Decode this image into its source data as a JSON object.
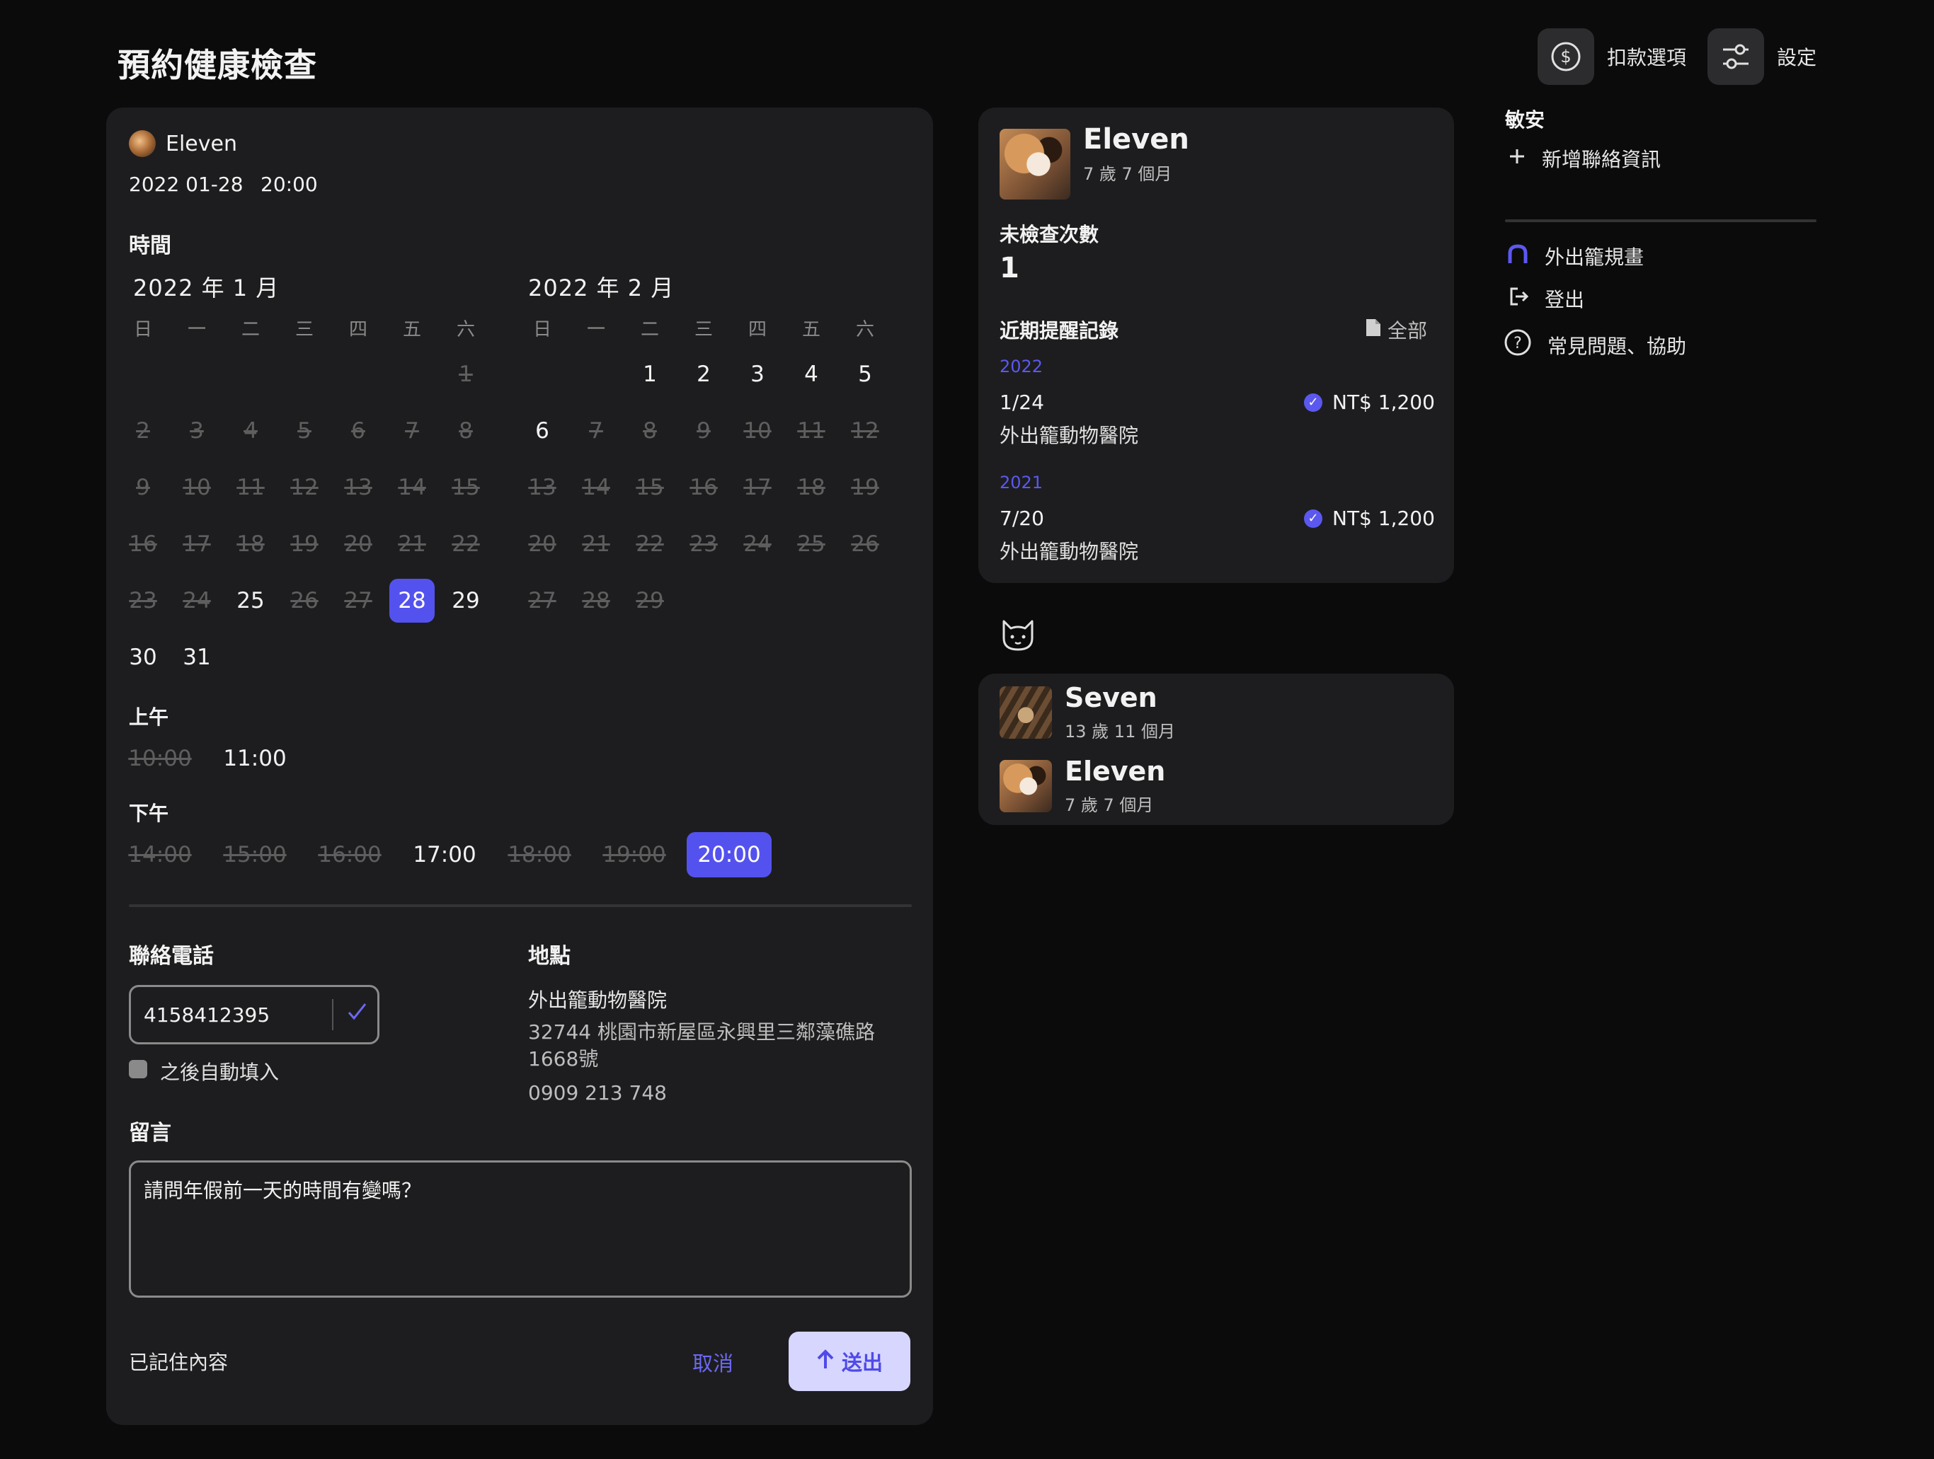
{
  "page": {
    "title": "預約健康檢查"
  },
  "top_actions": {
    "payment_label": "扣款選項",
    "settings_label": "設定"
  },
  "booking": {
    "pet_name": "Eleven",
    "date": "2022 01-28",
    "time": "20:00",
    "time_heading": "時間",
    "weekdays": [
      "日",
      "一",
      "二",
      "三",
      "四",
      "五",
      "六"
    ],
    "jan": {
      "title": "2022 年 1 月",
      "days": [
        {
          "d": "",
          "s": "empty"
        },
        {
          "d": "",
          "s": "empty"
        },
        {
          "d": "",
          "s": "empty"
        },
        {
          "d": "",
          "s": "empty"
        },
        {
          "d": "",
          "s": "empty"
        },
        {
          "d": "",
          "s": "empty"
        },
        {
          "d": "1",
          "s": "off"
        },
        {
          "d": "2",
          "s": "off"
        },
        {
          "d": "3",
          "s": "off"
        },
        {
          "d": "4",
          "s": "off"
        },
        {
          "d": "5",
          "s": "off"
        },
        {
          "d": "6",
          "s": "off"
        },
        {
          "d": "7",
          "s": "off"
        },
        {
          "d": "8",
          "s": "off"
        },
        {
          "d": "9",
          "s": "off"
        },
        {
          "d": "10",
          "s": "off"
        },
        {
          "d": "11",
          "s": "off"
        },
        {
          "d": "12",
          "s": "off"
        },
        {
          "d": "13",
          "s": "off"
        },
        {
          "d": "14",
          "s": "off"
        },
        {
          "d": "15",
          "s": "off"
        },
        {
          "d": "16",
          "s": "off"
        },
        {
          "d": "17",
          "s": "off"
        },
        {
          "d": "18",
          "s": "off"
        },
        {
          "d": "19",
          "s": "off"
        },
        {
          "d": "20",
          "s": "off"
        },
        {
          "d": "21",
          "s": "off"
        },
        {
          "d": "22",
          "s": "off"
        },
        {
          "d": "23",
          "s": "off"
        },
        {
          "d": "24",
          "s": "off"
        },
        {
          "d": "25",
          "s": "on"
        },
        {
          "d": "26",
          "s": "off"
        },
        {
          "d": "27",
          "s": "off"
        },
        {
          "d": "28",
          "s": "sel"
        },
        {
          "d": "29",
          "s": "on"
        },
        {
          "d": "30",
          "s": "on"
        },
        {
          "d": "31",
          "s": "on"
        }
      ]
    },
    "feb": {
      "title": "2022 年 2 月",
      "days": [
        {
          "d": "",
          "s": "empty"
        },
        {
          "d": "",
          "s": "empty"
        },
        {
          "d": "1",
          "s": "on"
        },
        {
          "d": "2",
          "s": "on"
        },
        {
          "d": "3",
          "s": "on"
        },
        {
          "d": "4",
          "s": "on"
        },
        {
          "d": "5",
          "s": "on"
        },
        {
          "d": "6",
          "s": "on"
        },
        {
          "d": "7",
          "s": "off"
        },
        {
          "d": "8",
          "s": "off"
        },
        {
          "d": "9",
          "s": "off"
        },
        {
          "d": "10",
          "s": "off"
        },
        {
          "d": "11",
          "s": "off"
        },
        {
          "d": "12",
          "s": "off"
        },
        {
          "d": "13",
          "s": "off"
        },
        {
          "d": "14",
          "s": "off"
        },
        {
          "d": "15",
          "s": "off"
        },
        {
          "d": "16",
          "s": "off"
        },
        {
          "d": "17",
          "s": "off"
        },
        {
          "d": "18",
          "s": "off"
        },
        {
          "d": "19",
          "s": "off"
        },
        {
          "d": "20",
          "s": "off"
        },
        {
          "d": "21",
          "s": "off"
        },
        {
          "d": "22",
          "s": "off"
        },
        {
          "d": "23",
          "s": "off"
        },
        {
          "d": "24",
          "s": "off"
        },
        {
          "d": "25",
          "s": "off"
        },
        {
          "d": "26",
          "s": "off"
        },
        {
          "d": "27",
          "s": "off"
        },
        {
          "d": "28",
          "s": "off"
        },
        {
          "d": "29",
          "s": "off"
        }
      ]
    },
    "morning_label": "上午",
    "morning_slots": [
      {
        "t": "10:00",
        "s": "off"
      },
      {
        "t": "11:00",
        "s": "on"
      }
    ],
    "afternoon_label": "下午",
    "afternoon_slots": [
      {
        "t": "14:00",
        "s": "off"
      },
      {
        "t": "15:00",
        "s": "off"
      },
      {
        "t": "16:00",
        "s": "off"
      },
      {
        "t": "17:00",
        "s": "on"
      },
      {
        "t": "18:00",
        "s": "off"
      },
      {
        "t": "19:00",
        "s": "off"
      },
      {
        "t": "20:00",
        "s": "sel"
      }
    ],
    "phone_label": "聯絡電話",
    "phone_value": "4158412395",
    "autofill_label": "之後自動填入",
    "location_label": "地點",
    "clinic_name": "外出籠動物醫院",
    "clinic_address": "32744 桃園市新屋區永興里三鄰藻礁路 1668號",
    "clinic_phone": "0909 213 748",
    "message_label": "留言",
    "message_value": "請問年假前一天的時間有變嗎？",
    "remembered_label": "已記住內容",
    "cancel_label": "取消",
    "send_label": "送出"
  },
  "pet_profile": {
    "name": "Eleven",
    "age": "7 歲 7 個月",
    "unchecked_label": "未檢查次數",
    "unchecked_count": "1",
    "reminders_label": "近期提醒記錄",
    "all_label": "全部",
    "records": [
      {
        "year": "2022",
        "date": "1/24",
        "clinic": "外出籠動物醫院",
        "amount": "NT$ 1,200"
      },
      {
        "year": "2021",
        "date": "7/20",
        "clinic": "外出籠動物醫院",
        "amount": "NT$ 1,200"
      }
    ]
  },
  "pets": [
    {
      "name": "Seven",
      "age": "13 歲 11 個月"
    },
    {
      "name": "Eleven",
      "age": "7 歲 7 個月"
    }
  ],
  "sidebar": {
    "user_name": "敏安",
    "add_contact_label": "新增聯絡資訊",
    "items": [
      {
        "label": "外出籠規畫",
        "icon": "plan-arch-icon"
      },
      {
        "label": "登出",
        "icon": "logout-icon"
      },
      {
        "label": "常見問題、協助",
        "icon": "help-circle-icon"
      }
    ]
  },
  "colors": {
    "accent": "#5452ee",
    "background": "#0b0b0c",
    "card": "#1d1d1f",
    "send_button_bg": "#d7d6ff"
  }
}
